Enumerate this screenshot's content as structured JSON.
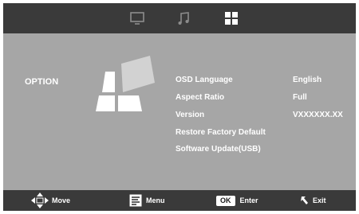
{
  "tabs": [
    {
      "icon": "tv-icon",
      "active": false
    },
    {
      "icon": "music-note-icon",
      "active": false
    },
    {
      "icon": "option-grid-icon",
      "active": true
    }
  ],
  "section": {
    "title": "OPTION"
  },
  "menu": {
    "items": [
      {
        "label": "OSD Language",
        "value": "English"
      },
      {
        "label": "Aspect Ratio",
        "value": "Full"
      },
      {
        "label": "Version",
        "value": "VXXXXXX.XX"
      },
      {
        "label": "Restore Factory Default",
        "value": ""
      },
      {
        "label": "Software Update(USB)",
        "value": ""
      }
    ]
  },
  "footer": {
    "move_label": "Move",
    "menu_label": "Menu",
    "ok_key": "OK",
    "enter_label": "Enter",
    "exit_label": "Exit"
  },
  "colors": {
    "bar_background": "#3a3a3a",
    "panel_background": "#a6a6a6",
    "text": "#ffffff"
  }
}
